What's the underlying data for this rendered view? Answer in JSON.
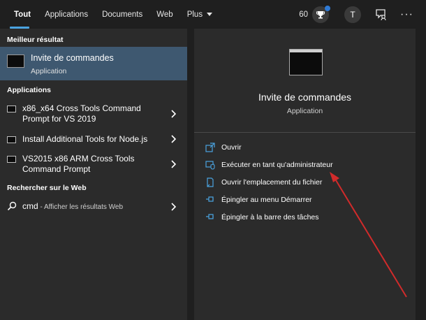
{
  "tabs": [
    {
      "label": "Tout"
    },
    {
      "label": "Applications"
    },
    {
      "label": "Documents"
    },
    {
      "label": "Web"
    },
    {
      "label": "Plus"
    }
  ],
  "topbar": {
    "points": "60",
    "avatar_letter": "T",
    "more_label": "···"
  },
  "left": {
    "best_section": "Meilleur résultat",
    "best": {
      "title": "Invite de commandes",
      "subtitle": "Application"
    },
    "apps_section": "Applications",
    "apps": [
      {
        "label": "x86_x64 Cross Tools Command Prompt for VS 2019"
      },
      {
        "label": "Install Additional Tools for Node.js"
      },
      {
        "label": "VS2015 x86 ARM Cross Tools Command Prompt"
      }
    ],
    "web_section": "Rechercher sur le Web",
    "web": {
      "query": "cmd",
      "sub": " - Afficher les résultats Web"
    }
  },
  "right": {
    "title": "Invite de commandes",
    "subtitle": "Application",
    "actions": [
      {
        "label": "Ouvrir",
        "icon": "open-icon"
      },
      {
        "label": "Exécuter en tant qu'administrateur",
        "icon": "run-as-admin-icon"
      },
      {
        "label": "Ouvrir l'emplacement du fichier",
        "icon": "file-location-icon"
      },
      {
        "label": "Épingler au menu Démarrer",
        "icon": "pin-icon"
      },
      {
        "label": "Épingler à la barre des tâches",
        "icon": "pin-icon"
      }
    ]
  },
  "colors": {
    "accent": "#4aa3e0",
    "selected": "#3e5870",
    "annotation_arrow": "#d12b2b"
  }
}
